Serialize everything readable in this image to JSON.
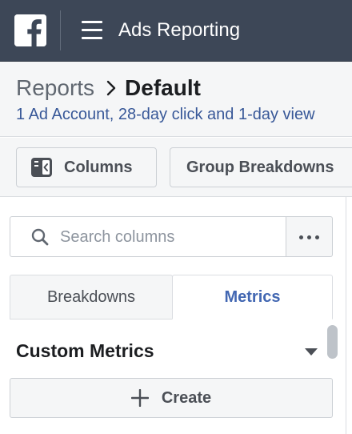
{
  "topbar": {
    "logo": "facebook-logo",
    "menu_icon": "hamburger-menu-icon",
    "title": "Ads Reporting"
  },
  "header": {
    "breadcrumb_parent": "Reports",
    "breadcrumb_separator_icon": "chevron-right-icon",
    "breadcrumb_current": "Default",
    "subtitle": "1 Ad Account, 28-day click and 1-day view"
  },
  "toolbar": {
    "columns_icon": "columns-panel-icon",
    "columns_label": "Columns",
    "group_breakdowns_label": "Group Breakdowns"
  },
  "panel": {
    "search": {
      "icon": "search-icon",
      "placeholder": "Search columns",
      "value": ""
    },
    "more_icon": "more-dots-icon",
    "tabs": [
      {
        "label": "Breakdowns",
        "selected": false
      },
      {
        "label": "Metrics",
        "selected": true
      }
    ],
    "section": {
      "title": "Custom Metrics",
      "collapse_icon": "caret-down-icon"
    },
    "create": {
      "icon": "plus-icon",
      "label": "Create"
    }
  },
  "colors": {
    "topbar_bg": "#3d4757",
    "accent_blue": "#4267b2",
    "link_blue": "#385898",
    "panel_bg": "#f5f6f7"
  }
}
